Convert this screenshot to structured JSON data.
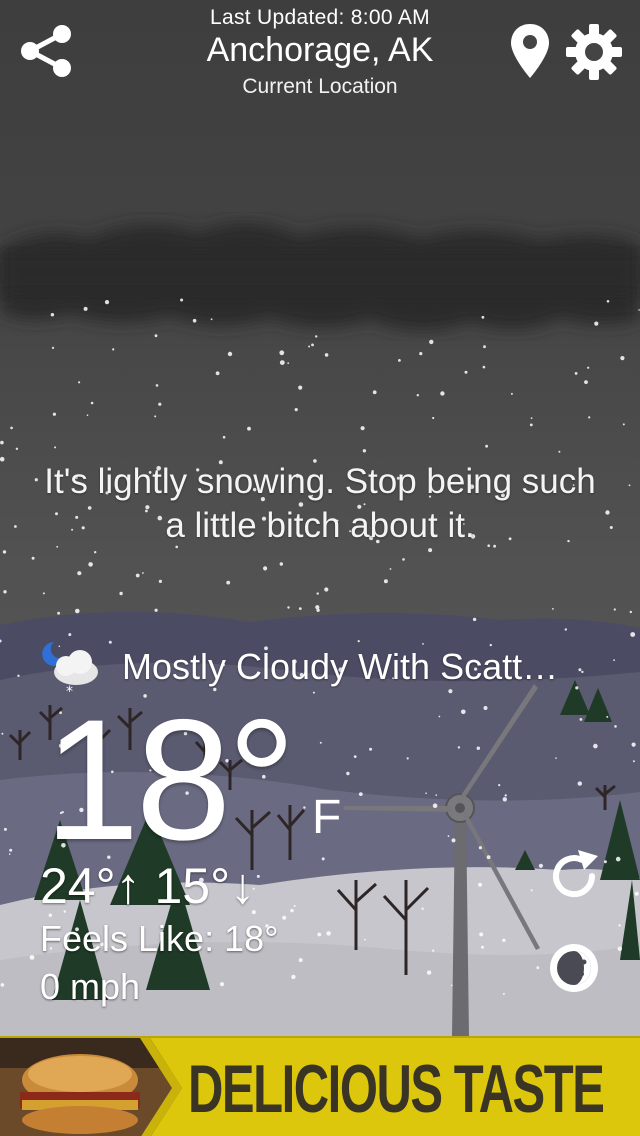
{
  "header": {
    "last_updated": "Last Updated: 8:00 AM",
    "city": "Anchorage, AK",
    "sublocation": "Current Location",
    "share_icon": "share-icon",
    "location_icon": "map-pin-icon",
    "settings_icon": "gear-icon"
  },
  "message": "It's lightly snowing. Stop being such a little bitch about it.",
  "conditions": {
    "icon": "night-cloudy-snow-icon",
    "text": "Mostly Cloudy With Scatt…"
  },
  "temperature": {
    "current": "18°",
    "unit": "F",
    "hilo": "24°↑ 15°↓",
    "feels_like": "Feels Like: 18°",
    "wind": "0 mph"
  },
  "controls": {
    "refresh_icon": "refresh-icon",
    "moon_icon": "moon-phase-icon"
  },
  "ad": {
    "text": "DELICIOUS TASTE"
  },
  "colors": {
    "sky": "#4a4a4a",
    "cloud": "#2c2c2c",
    "hills": "#55556a",
    "snow_ground": "#c9c9cf",
    "ad_bg": "#dcc70d",
    "ad_text": "#3a3424"
  }
}
